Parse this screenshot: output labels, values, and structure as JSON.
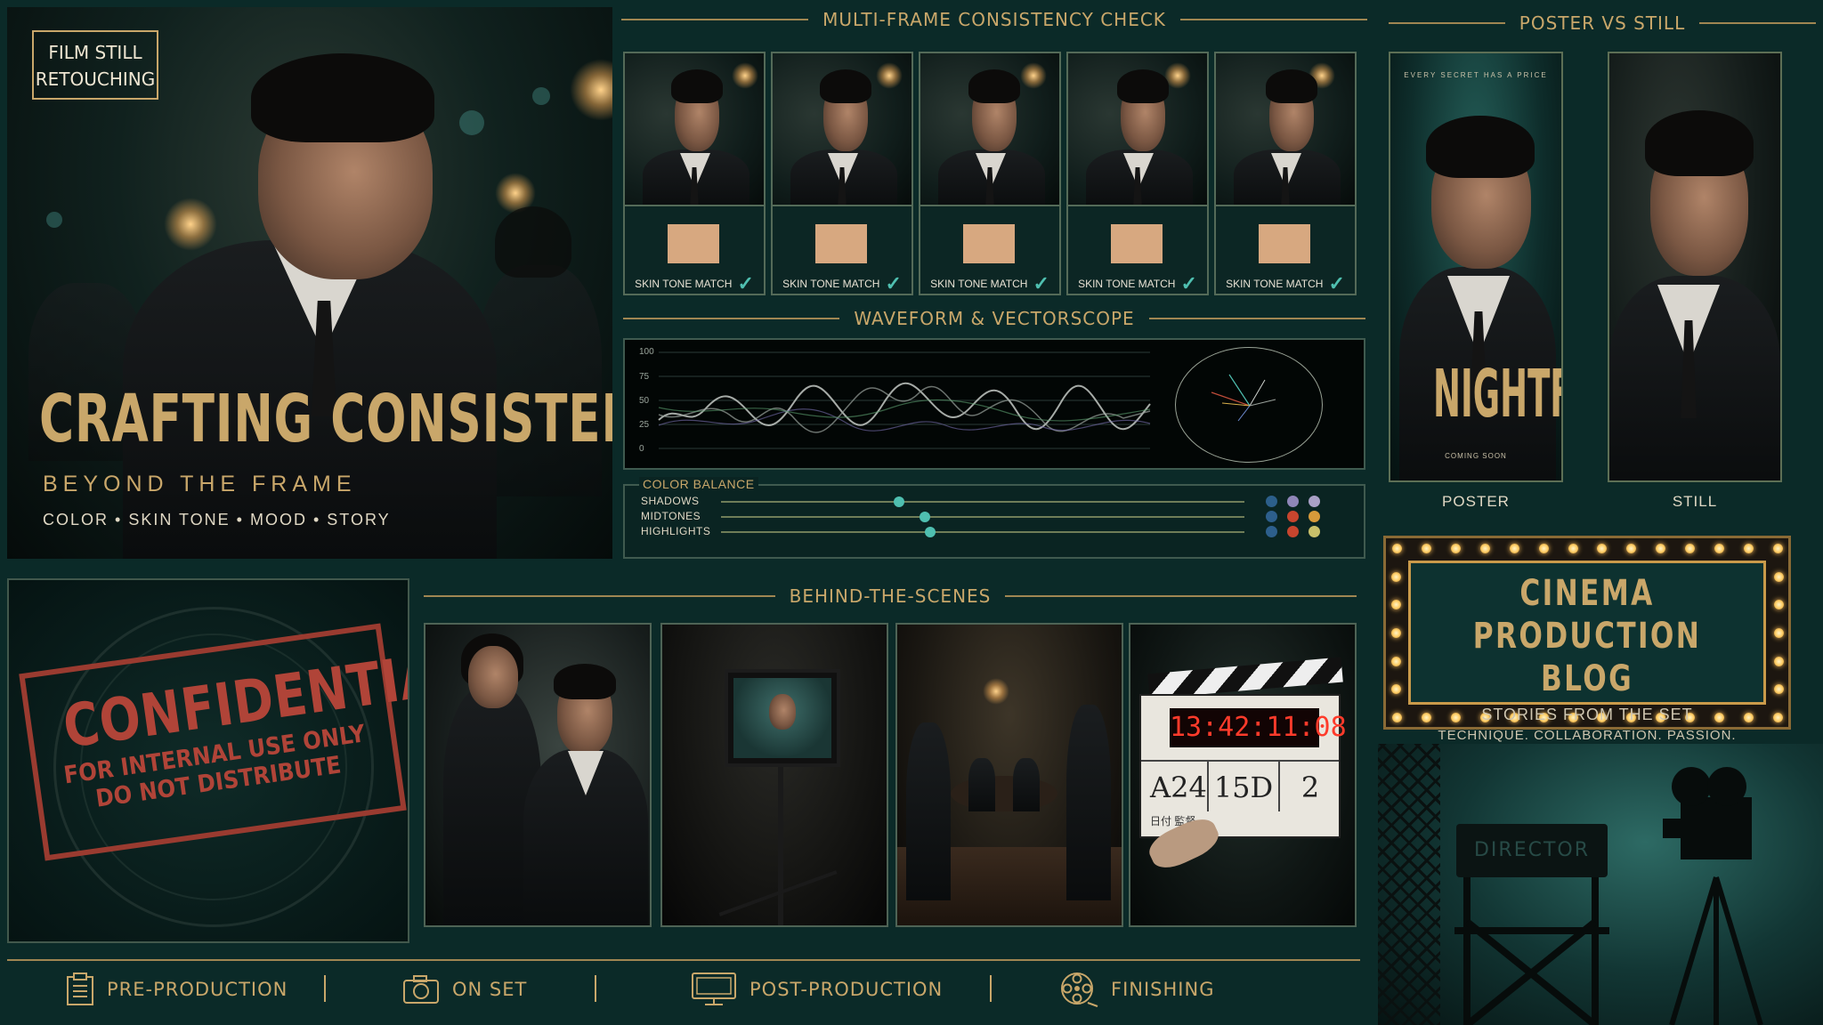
{
  "hero": {
    "badge_line1": "FILM STILL",
    "badge_line2": "RETOUCHING",
    "title": "CRAFTING CONSISTENCY",
    "subtitle": "BEYOND THE FRAME",
    "tags": "COLOR • SKIN TONE • MOOD • STORY"
  },
  "consistency": {
    "heading": "MULTI-FRAME CONSISTENCY CHECK",
    "frames": [
      {
        "label": "SKIN TONE MATCH"
      },
      {
        "label": "SKIN TONE MATCH"
      },
      {
        "label": "SKIN TONE MATCH"
      },
      {
        "label": "SKIN TONE MATCH"
      },
      {
        "label": "SKIN TONE MATCH"
      }
    ],
    "swatch_color": "#d7a880"
  },
  "waveform": {
    "heading": "WAVEFORM & VECTORSCOPE",
    "ticks": [
      "100",
      "75",
      "50",
      "25",
      "0"
    ]
  },
  "color_balance": {
    "heading": "COLOR BALANCE",
    "rows": [
      {
        "label": "SHADOWS",
        "value": 0.34,
        "dots": [
          "#2c5f8a",
          "#8f86b8",
          "#a9a0c6"
        ]
      },
      {
        "label": "MIDTONES",
        "value": 0.39,
        "dots": [
          "#2d5f8c",
          "#c8452e",
          "#d79a3a"
        ]
      },
      {
        "label": "HIGHLIGHTS",
        "value": 0.4,
        "dots": [
          "#2d5f8c",
          "#c8452e",
          "#c9c06a"
        ]
      }
    ]
  },
  "poster_vs_still": {
    "heading": "POSTER VS STILL",
    "poster_tagline": "EVERY SECRET HAS A PRICE",
    "poster_title": "NIGHTFALL",
    "poster_footer": "COMING SOON",
    "poster_label": "POSTER",
    "still_label": "STILL"
  },
  "confidential": {
    "title": "CONFIDENTIAL",
    "line1": "FOR INTERNAL USE ONLY",
    "line2": "DO NOT DISTRIBUTE"
  },
  "bts": {
    "heading": "BEHIND-THE-SCENES",
    "clapper_timecode": "13:42:11:08",
    "clapper_roll": "A24",
    "clapper_scene": "15D",
    "clapper_take": "2",
    "clapper_small": "日付 監督"
  },
  "marquee": {
    "title_line1": "CINEMA",
    "title_line2": "PRODUCTION BLOG",
    "sub": "STORIES FROM THE SET",
    "sub2": "TECHNIQUE. COLLABORATION. PASSION."
  },
  "director": {
    "chair_text": "DIRECTOR"
  },
  "nav": [
    {
      "label": "PRE-PRODUCTION",
      "icon": "clipboard-icon"
    },
    {
      "label": "ON SET",
      "icon": "camera-icon"
    },
    {
      "label": "POST-PRODUCTION",
      "icon": "monitor-icon"
    },
    {
      "label": "FINISHING",
      "icon": "film-reel-icon"
    }
  ],
  "colors": {
    "background": "#0b2a28",
    "gold": "#c9a76a",
    "teal_accent": "#4fbfb0",
    "stamp_red": "#b04438"
  }
}
